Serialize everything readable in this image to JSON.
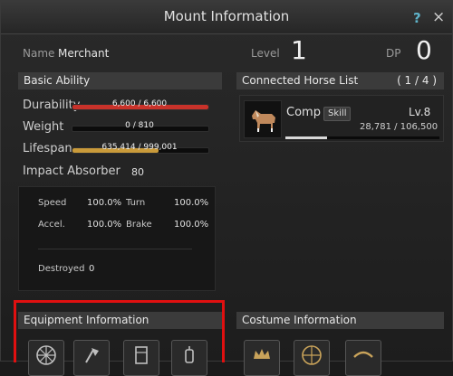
{
  "window": {
    "title": "Mount Information",
    "help": "?",
    "close": "×"
  },
  "header": {
    "name_label": "Name",
    "name_value": "Merchant",
    "level_label": "Level",
    "level_value": "1",
    "dp_label": "DP",
    "dp_value": "0"
  },
  "basic_ability": {
    "title": "Basic Ability",
    "durability": {
      "label": "Durability",
      "text": "6,600 / 6,600",
      "fraction": 1.0,
      "color": "#c8322a"
    },
    "weight": {
      "label": "Weight",
      "text": "0 / 810",
      "fraction": 0.0,
      "color": "#8a8a8a"
    },
    "lifespan": {
      "label": "Lifespan",
      "text": "635,414 / 999,001",
      "fraction": 0.636,
      "color": "#c99a3a"
    },
    "impact_absorber": {
      "label": "Impact Absorber",
      "value": "80"
    },
    "stats": {
      "speed_label": "Speed",
      "speed_value": "100.0%",
      "turn_label": "Turn",
      "turn_value": "100.0%",
      "accel_label": "Accel.",
      "accel_value": "100.0%",
      "brake_label": "Brake",
      "brake_value": "100.0%"
    },
    "destroyed_label": "Destroyed",
    "destroyed_value": "0"
  },
  "connected_horses": {
    "title": "Connected Horse List",
    "page": "( 1 / 4 )",
    "horse": {
      "name": "Comp",
      "skill_badge": "Skill",
      "level": "Lv.8",
      "exp_text": "28,781 / 106,500",
      "exp_fraction": 0.27
    }
  },
  "equipment": {
    "title": "Equipment Information",
    "slots": [
      "wheel-icon",
      "axe-icon",
      "banner-icon",
      "lantern-icon"
    ]
  },
  "costume": {
    "title": "Costume Information",
    "slots": [
      "crown-icon",
      "wheel-icon",
      "horns-icon"
    ]
  },
  "colors": {
    "highlight_box": "#e01010",
    "accent": "#5fb3c9"
  }
}
